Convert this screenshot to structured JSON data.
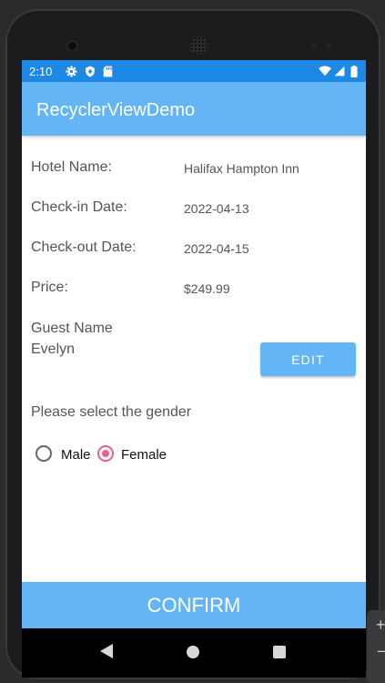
{
  "status_bar": {
    "time": "2:10",
    "left_icons": [
      "gear-icon",
      "shield-icon",
      "sd-card-icon"
    ],
    "right_icons": [
      "wifi-icon",
      "signal-icon",
      "battery-icon"
    ]
  },
  "app_bar": {
    "title": "RecyclerViewDemo"
  },
  "details": [
    {
      "label": "Hotel Name:",
      "value": "Halifax Hampton Inn"
    },
    {
      "label": "Check-in Date:",
      "value": "2022-04-13"
    },
    {
      "label": "Check-out Date:",
      "value": "2022-04-15"
    },
    {
      "label": "Price:",
      "value": "$249.99"
    }
  ],
  "guest": {
    "heading": "Guest Name",
    "name": "Evelyn",
    "edit_label": "EDIT"
  },
  "gender": {
    "prompt": "Please select the gender",
    "options": [
      "Male",
      "Female"
    ],
    "selected": "Female",
    "accent_color": "#ec5f8c"
  },
  "confirm_label": "CONFIRM",
  "colors": {
    "status_bar": "#1e88e5",
    "primary": "#64b5f6"
  },
  "nav_bar": {
    "icons": [
      "back-icon",
      "home-icon",
      "recents-icon"
    ]
  },
  "emulator_side_controls": {
    "zoom_in": "+",
    "zoom_out": "–"
  }
}
